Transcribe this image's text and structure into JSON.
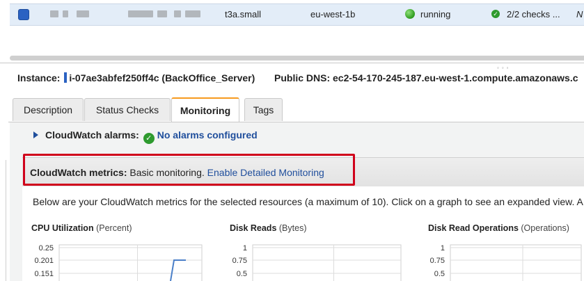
{
  "instance_row": {
    "type": "t3a.small",
    "zone": "eu-west-1b",
    "state": "running",
    "checks": "2/2 checks ...",
    "next_col": "N",
    "colors": {
      "selected_row": "#e3edf8",
      "running": "#2d9a1e"
    },
    "icons": {
      "state": "status-dot-icon",
      "checks": "check-circle-icon"
    }
  },
  "instance_header": {
    "label": "Instance:",
    "id": "i-07ae3abfef250ff4c (BackOffice_Server)",
    "dns_label": "Public DNS:",
    "dns": "ec2-54-170-245-187.eu-west-1.compute.amazonaws.c"
  },
  "tabs": [
    {
      "label": "Description"
    },
    {
      "label": "Status Checks"
    },
    {
      "label": "Monitoring"
    },
    {
      "label": "Tags"
    }
  ],
  "active_tab": "Monitoring",
  "alarms": {
    "label": "CloudWatch alarms:",
    "status": "No alarms configured"
  },
  "metrics": {
    "label": "CloudWatch metrics:",
    "mode": "Basic monitoring.",
    "enable_link": "Enable Detailed Monitoring"
  },
  "description": "Below are your CloudWatch metrics for the selected resources (a maximum of 10). Click on a graph to see an expanded view. A",
  "charts": [
    {
      "title": "CPU Utilization",
      "unit": "(Percent)",
      "ticks": [
        "0.25",
        "0.201",
        "0.151"
      ]
    },
    {
      "title": "Disk Reads",
      "unit": "(Bytes)",
      "ticks": [
        "1",
        "0.75",
        "0.5"
      ]
    },
    {
      "title": "Disk Read Operations",
      "unit": "(Operations)",
      "ticks": [
        "1",
        "0.75",
        "0.5"
      ]
    }
  ],
  "chart_data": [
    {
      "type": "line",
      "title": "CPU Utilization",
      "ylim": [
        0.1,
        0.25
      ],
      "yticks": [
        0.25,
        0.201,
        0.151
      ],
      "series": [
        {
          "values": [
            0.12,
            0.201,
            0.201
          ]
        }
      ]
    },
    {
      "type": "line",
      "title": "Disk Reads",
      "ylim": [
        0,
        1
      ],
      "yticks": [
        1,
        0.75,
        0.5
      ],
      "series": []
    },
    {
      "type": "line",
      "title": "Disk Read Operations",
      "ylim": [
        0,
        1
      ],
      "yticks": [
        1,
        0.75,
        0.5
      ],
      "series": []
    }
  ],
  "accent_colors": {
    "active_tab": "#f79a1e",
    "link": "#1f4e9c",
    "highlight_box": "#d0021b",
    "chart_line": "#4a7fc8"
  }
}
